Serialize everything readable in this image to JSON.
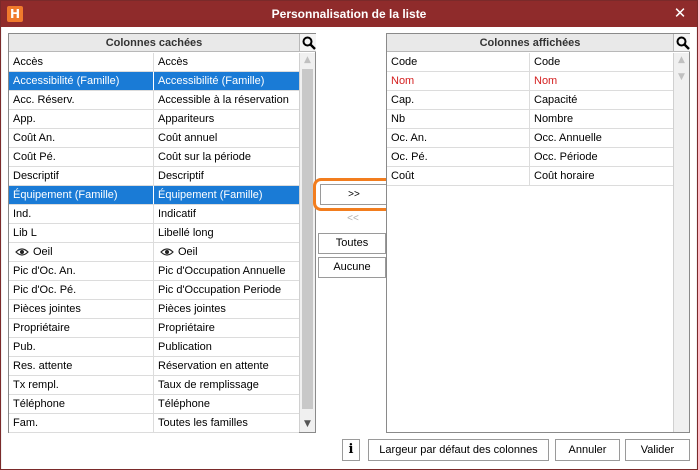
{
  "window": {
    "app_logo": "H",
    "title": "Personnalisation de la liste",
    "close_symbol": "✕"
  },
  "hidden_columns": {
    "header": "Colonnes cachées",
    "rows": [
      {
        "code": "Accès",
        "label": "Accès",
        "selected": false
      },
      {
        "code": "Accessibilité (Famille)",
        "label": "Accessibilité (Famille)",
        "selected": true
      },
      {
        "code": "Acc. Réserv.",
        "label": "Accessible à la réservation",
        "selected": false
      },
      {
        "code": "App.",
        "label": "Appariteurs",
        "selected": false
      },
      {
        "code": "Coût An.",
        "label": "Coût annuel",
        "selected": false
      },
      {
        "code": "Coût Pé.",
        "label": "Coût sur la période",
        "selected": false
      },
      {
        "code": "Descriptif",
        "label": "Descriptif",
        "selected": false
      },
      {
        "code": "Équipement (Famille)",
        "label": "Équipement (Famille)",
        "selected": true
      },
      {
        "code": "Ind.",
        "label": "Indicatif",
        "selected": false
      },
      {
        "code": "Lib L",
        "label": "Libellé long",
        "selected": false
      },
      {
        "code": "Oeil",
        "label": "Oeil",
        "selected": false,
        "icon": "eye-icon"
      },
      {
        "code": "Pic d'Oc. An.",
        "label": "Pic d'Occupation Annuelle",
        "selected": false
      },
      {
        "code": "Pic d'Oc. Pé.",
        "label": "Pic d'Occupation Periode",
        "selected": false
      },
      {
        "code": "Pièces jointes",
        "label": "Pièces jointes",
        "selected": false
      },
      {
        "code": "Propriétaire",
        "label": "Propriétaire",
        "selected": false
      },
      {
        "code": "Pub.",
        "label": "Publication",
        "selected": false
      },
      {
        "code": "Res. attente",
        "label": "Réservation en attente",
        "selected": false
      },
      {
        "code": "Tx rempl.",
        "label": "Taux de remplissage",
        "selected": false
      },
      {
        "code": "Téléphone",
        "label": "Téléphone",
        "selected": false
      },
      {
        "code": "Fam.",
        "label": "Toutes les familles",
        "selected": false
      }
    ]
  },
  "shown_columns": {
    "header": "Colonnes affichées",
    "rows": [
      {
        "code": "Code",
        "label": "Code",
        "red": false
      },
      {
        "code": "Nom",
        "label": "Nom",
        "red": true
      },
      {
        "code": "Cap.",
        "label": "Capacité",
        "red": false
      },
      {
        "code": "Nb",
        "label": "Nombre",
        "red": false
      },
      {
        "code": "Oc. An.",
        "label": "Occ. Annuelle",
        "red": false
      },
      {
        "code": "Oc. Pé.",
        "label": "Occ. Période",
        "red": false
      },
      {
        "code": "Coût",
        "label": "Coût horaire",
        "red": false
      }
    ]
  },
  "transfer": {
    "move_right_label": ">>",
    "move_left_label": "<<",
    "all_label": "Toutes",
    "none_label": "Aucune"
  },
  "footer": {
    "info_label": "i",
    "default_width_label": "Largeur par défaut des colonnes",
    "cancel_label": "Annuler",
    "ok_label": "Valider"
  },
  "colors": {
    "titlebar": "#8f2b2b",
    "selection": "#1a7bd6",
    "highlight": "#f27d1e",
    "required_text": "#d42020"
  }
}
